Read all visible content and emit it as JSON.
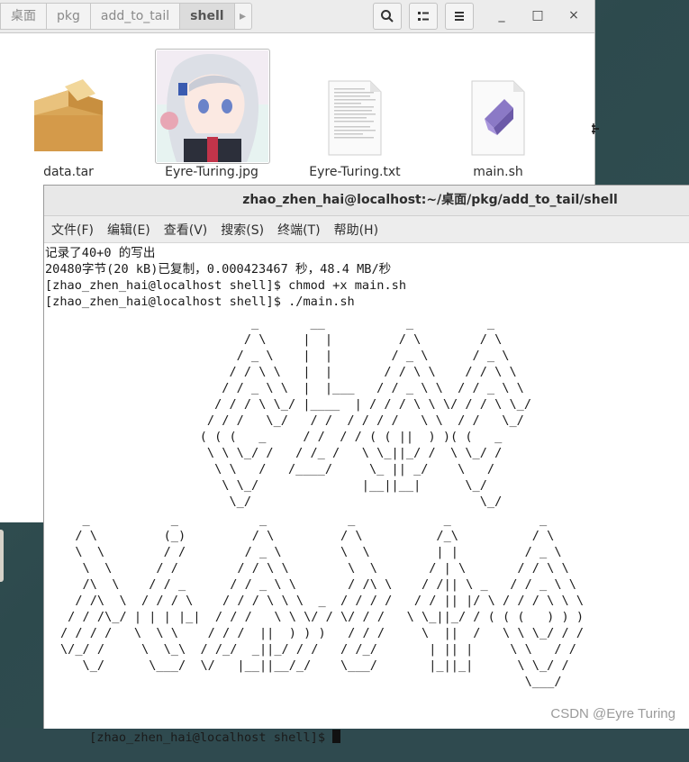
{
  "file_manager": {
    "breadcrumbs": [
      "桌面",
      "pkg",
      "add_to_tail",
      "shell"
    ],
    "active_crumb": "shell",
    "files": [
      {
        "name": "data.tar",
        "icon": "archive-icon"
      },
      {
        "name": "Eyre-Turing.jpg",
        "icon": "image-thumbnail"
      },
      {
        "name": "Eyre-Turing.txt",
        "icon": "text-file-icon"
      },
      {
        "name": "main.sh",
        "icon": "script-file-icon"
      }
    ],
    "window_buttons": [
      "_",
      "□",
      "×"
    ]
  },
  "terminal": {
    "title": "zhao_zhen_hai@localhost:~/桌面/pkg/add_to_tail/shell",
    "menu": [
      "文件(F)",
      "编辑(E)",
      "查看(V)",
      "搜索(S)",
      "终端(T)",
      "帮助(H)"
    ],
    "lines": [
      "记录了40+0 的写出",
      "20480字节(20 kB)已复制，0.000423467 秒，48.4 MB/秒",
      "[zhao_zhen_hai@localhost shell]$ chmod +x main.sh",
      "[zhao_zhen_hai@localhost shell]$ ./main.sh"
    ],
    "art_top": "           _       __           _          _\n          / \\     |  |         / \\        / \\\n         / _ \\    |  |        / _ \\      / _ \\\n        / / \\ \\   |  |       / / \\ \\    / / \\ \\\n       / / _ \\ \\  |  |___   / / _ \\ \\  / / _ \\ \\\n      / / / \\ \\_/ |____  | / / / \\ \\ \\/ / / \\ \\_/\n     / / /   \\_/   / /  / / / /   \\ \\  / /   \\_/\n    ( ( (   _     / /  / / ( ( ||  ) )( (   _\n     \\ \\ \\_/ /   / /_ /   \\ \\_||_/ /  \\ \\_/ /\n      \\ \\   /   /____/     \\_ || _/    \\   /\n       \\ \\_/              |__||__|      \\_/\n        \\_/                               \\_/",
    "art_bottom": "   _           _           _           _            _            _\n  / \\         (_)         / \\         / \\          /_\\          / \\\n  \\  \\        / /        / _ \\        \\  \\         | |         / _ \\\n   \\  \\      / /        / / \\ \\        \\  \\       / | \\       / / \\ \\\n   /\\  \\    / / _      / / _ \\ \\       / /\\ \\    / /|| \\ _   / / _ \\ \\\n  / /\\  \\  / / / \\    / / / \\ \\ \\  _  / / / /   / / || |/ \\ / / / \\ \\ \\\n / / /\\_/ | | | |_|  / / /   \\ \\ \\/ / \\/ / /   \\ \\_||_/ / ( ( (   ) ) )\n/ / / /   \\  \\ \\    / / /  ||  ) ) )   / / /     \\  ||  /   \\ \\ \\_/ / /\n\\/_/ /     \\  \\_\\  / /_/  _||_/ / /   / /_/       | || |     \\ \\   / /\n   \\_/      \\___/  \\/   |__||__/_/    \\___/       |_||_|      \\ \\_/ /\n                                                               \\___/",
    "prompt": "[zhao_zhen_hai@localhost shell]$ "
  },
  "watermark": "CSDN @Eyre Turing"
}
